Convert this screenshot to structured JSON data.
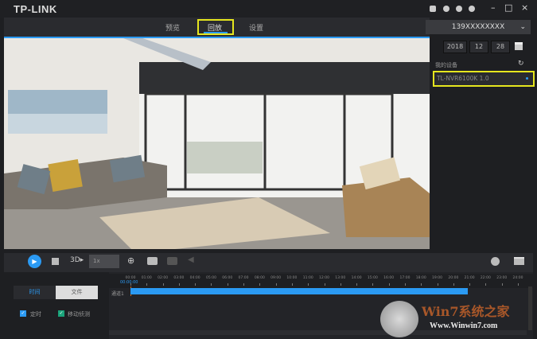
{
  "app": {
    "logo": "TP-LINK"
  },
  "tabs": [
    {
      "label": "预览"
    },
    {
      "label": "回放",
      "active": true
    },
    {
      "label": "设置"
    }
  ],
  "device_selector": {
    "value": "139XXXXXXXX"
  },
  "date": {
    "year": "2018",
    "month": "12",
    "day": "28"
  },
  "devices": {
    "header": "我的设备",
    "items": [
      {
        "label": "TL-NVR6100K 1.0"
      }
    ]
  },
  "controls": {
    "speed": "1x"
  },
  "mode_tabs": [
    {
      "label": "时间"
    },
    {
      "label": "文件",
      "active": true
    }
  ],
  "filters": [
    {
      "label": "定时",
      "checked": true,
      "color": "#2b9af3"
    },
    {
      "label": "移动侦测",
      "checked": true,
      "color": "#1aa37a"
    }
  ],
  "timeline": {
    "current_time": "00:00:00",
    "hours": [
      "00:00",
      "01:00",
      "02:00",
      "03:00",
      "04:00",
      "05:00",
      "06:00",
      "07:00",
      "08:00",
      "09:00",
      "10:00",
      "11:00",
      "12:00",
      "13:00",
      "14:00",
      "15:00",
      "16:00",
      "17:00",
      "18:00",
      "19:00",
      "20:00",
      "21:00",
      "22:00",
      "23:00",
      "24:00"
    ],
    "channel": "通道1",
    "recording": {
      "start_hour": 0,
      "end_hour": 20.9,
      "color": "#2b9af3"
    }
  },
  "watermark": {
    "text": "Win7系统之家",
    "url_text": "Www.Winwin7.com"
  },
  "accent": "#2b9af3"
}
